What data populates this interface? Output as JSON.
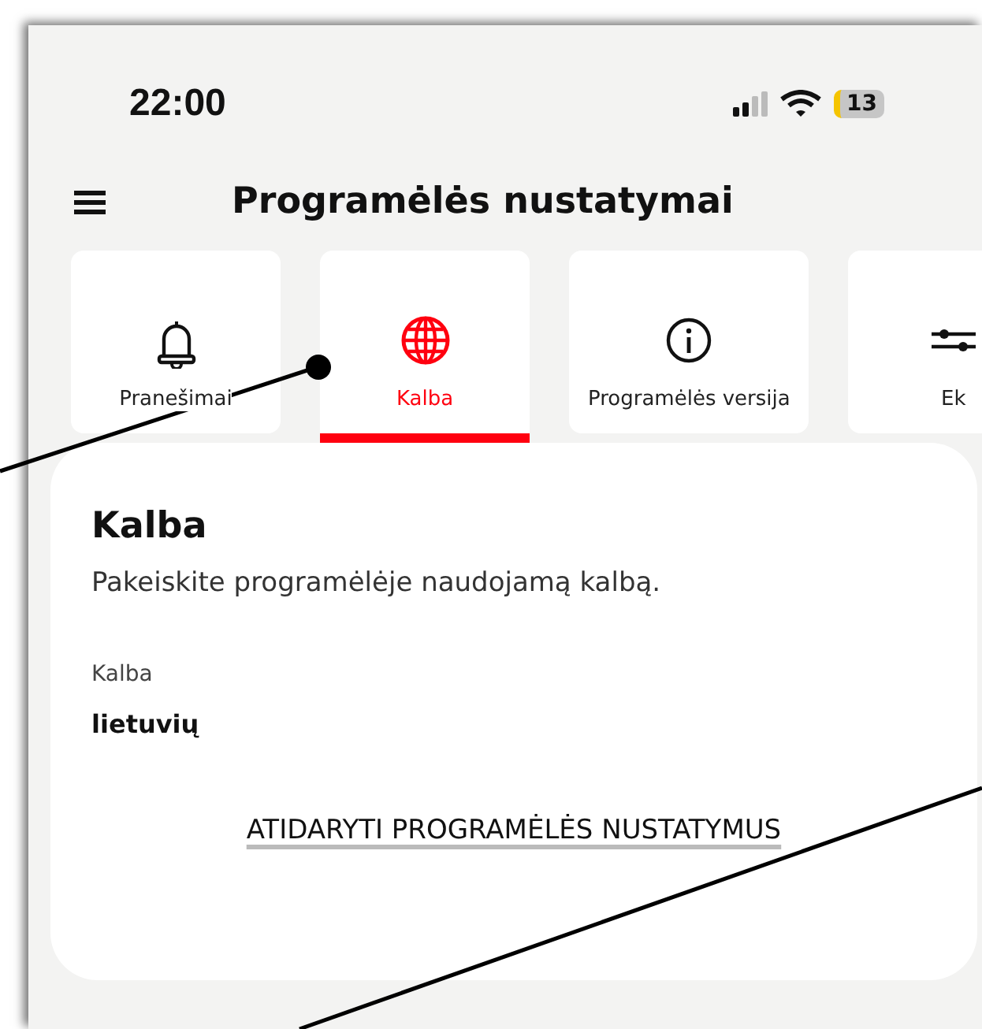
{
  "status_bar": {
    "time": "22:00",
    "battery": "13"
  },
  "header": {
    "title": "Programėlės nustatymai"
  },
  "tabs": [
    {
      "label": "Pranešimai",
      "kind": "bell",
      "selected": false
    },
    {
      "label": "Kalba",
      "kind": "globe",
      "selected": true
    },
    {
      "label": "Programėlės versija",
      "kind": "info",
      "selected": false
    },
    {
      "label": "Ek",
      "kind": "other",
      "selected": false
    }
  ],
  "card": {
    "title": "Kalba",
    "description": "Pakeiskite programėlėje naudojamą kalbą.",
    "field_label": "Kalba",
    "field_value": "lietuvių",
    "link": "ATIDARYTI PROGRAMĖLĖS NUSTATYMUS"
  }
}
